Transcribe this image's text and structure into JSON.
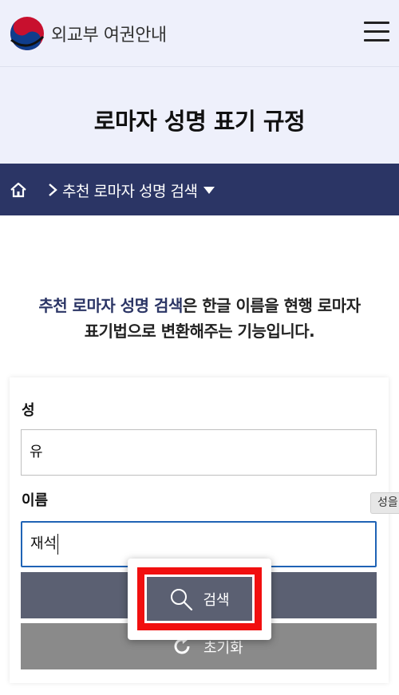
{
  "header": {
    "site_name": "외교부 여권안내",
    "menu_icon": "hamburger-menu-icon",
    "logo": "taegeuk-emblem"
  },
  "page": {
    "title": "로마자 성명 표기 규정"
  },
  "breadcrumb": {
    "home_icon": "home-icon",
    "current": "추천 로마자 성명 검색"
  },
  "intro": {
    "highlight": "추천 로마자 성명 검색",
    "text_after": "은 한글 이름을 현행 로마자",
    "line2": "표기법으로 변환해주는 기능입니다."
  },
  "form": {
    "surname_label": "성",
    "surname_value": "유",
    "given_label": "이름",
    "given_value": "재석",
    "search_label": "검색",
    "reset_label": "초기화"
  },
  "side_tab": {
    "label": "성을"
  },
  "colors": {
    "brand_navy": "#2b3565",
    "header_bg": "#eef0fb",
    "highlight_red": "#f10f0f",
    "focus_blue": "#1f63b5"
  }
}
